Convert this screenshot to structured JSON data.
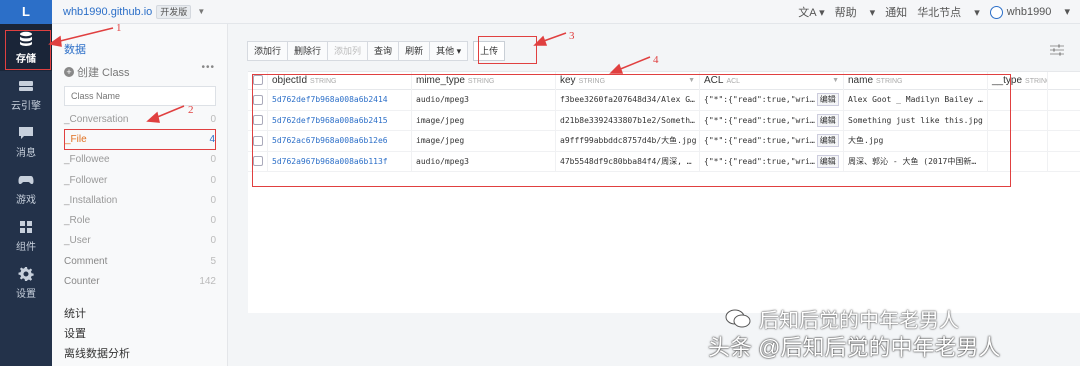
{
  "nav": {
    "logo": "L",
    "items": [
      {
        "label": "存储",
        "icon": "database-icon",
        "active": true
      },
      {
        "label": "云引擎",
        "icon": "server-icon"
      },
      {
        "label": "消息",
        "icon": "message-icon"
      },
      {
        "label": "游戏",
        "icon": "gamepad-icon"
      },
      {
        "label": "组件",
        "icon": "components-icon"
      },
      {
        "label": "设置",
        "icon": "gear-icon"
      }
    ]
  },
  "topbar": {
    "site": "whb1990.github.io",
    "badge": "开发版",
    "translate_icon": "translate-icon",
    "help": "帮助",
    "notice": "通知",
    "region": "华北节点",
    "user": "whb1990"
  },
  "sidebar": {
    "title": "数据",
    "create": "创建 Class",
    "search_placeholder": "Class Name",
    "classes": [
      {
        "name": "_Conversation",
        "count": "0"
      },
      {
        "name": "_File",
        "count": "4"
      },
      {
        "name": "_Followee",
        "count": "0"
      },
      {
        "name": "_Follower",
        "count": "0"
      },
      {
        "name": "_Installation",
        "count": "0"
      },
      {
        "name": "_Role",
        "count": "0"
      },
      {
        "name": "_User",
        "count": "0"
      },
      {
        "name": "Comment",
        "count": "5"
      },
      {
        "name": "Counter",
        "count": "142"
      }
    ],
    "links": [
      "统计",
      "设置",
      "离线数据分析"
    ]
  },
  "toolbar": {
    "add_row": "添加行",
    "delete_row": "删除行",
    "add_col": "添加列",
    "query": "查询",
    "refresh": "刷新",
    "more": "其他",
    "upload": "上传"
  },
  "grid": {
    "columns": [
      {
        "name": "objectId",
        "type": "STRING"
      },
      {
        "name": "mime_type",
        "type": "STRING"
      },
      {
        "name": "key",
        "type": "STRING"
      },
      {
        "name": "ACL",
        "type": "ACL"
      },
      {
        "name": "name",
        "type": "STRING"
      },
      {
        "name": "__type",
        "type": "STRING"
      }
    ],
    "edit_label": "编辑",
    "rows": [
      {
        "objectId": "5d762def7b968a008a6b2414",
        "mime": "audio/mpeg3",
        "key": "f3bee3260fa207648d34/Alex G…",
        "acl": "{\"*\":{\"read\":true,\"wri…",
        "name": "Alex Goot _ Madilyn Bailey …"
      },
      {
        "objectId": "5d762def7b968a008a6b2415",
        "mime": "image/jpeg",
        "key": "d21b8e3392433807b1e2/Someth…",
        "acl": "{\"*\":{\"read\":true,\"wri…",
        "name": "Something just like this.jpg"
      },
      {
        "objectId": "5d762ac67b968a008a6b12e6",
        "mime": "image/jpeg",
        "key": "a9fff99abbddc8757d4b/大鱼.jpg",
        "acl": "{\"*\":{\"read\":true,\"wri…",
        "name": "大鱼.jpg"
      },
      {
        "objectId": "5d762a967b968a008a6b113f",
        "mime": "audio/mpeg3",
        "key": "47b5548df9c80bba84f4/周深, …",
        "acl": "{\"*\":{\"read\":true,\"wri…",
        "name": "周深、郭沁 - 大鱼 (2017中国新…"
      }
    ]
  },
  "annotations": [
    "1",
    "2",
    "3",
    "4"
  ],
  "watermark": {
    "line1": "后知后觉的中年老男人",
    "line2": "头条 @后知后觉的中年老男人"
  }
}
